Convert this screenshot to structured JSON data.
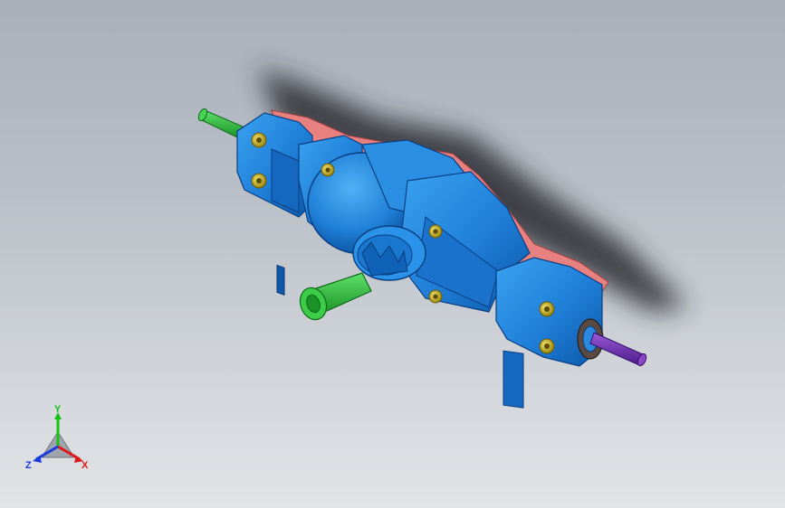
{
  "colors": {
    "background_top": "#a9b0ba",
    "background_bottom": "#e2e4e7",
    "housing_blue": "#1f86e0",
    "housing_blue_dark": "#0c4e9a",
    "gasket_red": "#e07b7b",
    "shaft_green": "#2dbb3a",
    "shaft_purple": "#6a2aa8",
    "bolt_yellow": "#d9c21a"
  },
  "triad": {
    "x_label": "X",
    "y_label": "Y",
    "z_label": "Z",
    "x_color": "#e01818",
    "y_color": "#18c018",
    "z_color": "#1a3ae0"
  },
  "model": {
    "icon": "differential-axle-housing-model"
  }
}
